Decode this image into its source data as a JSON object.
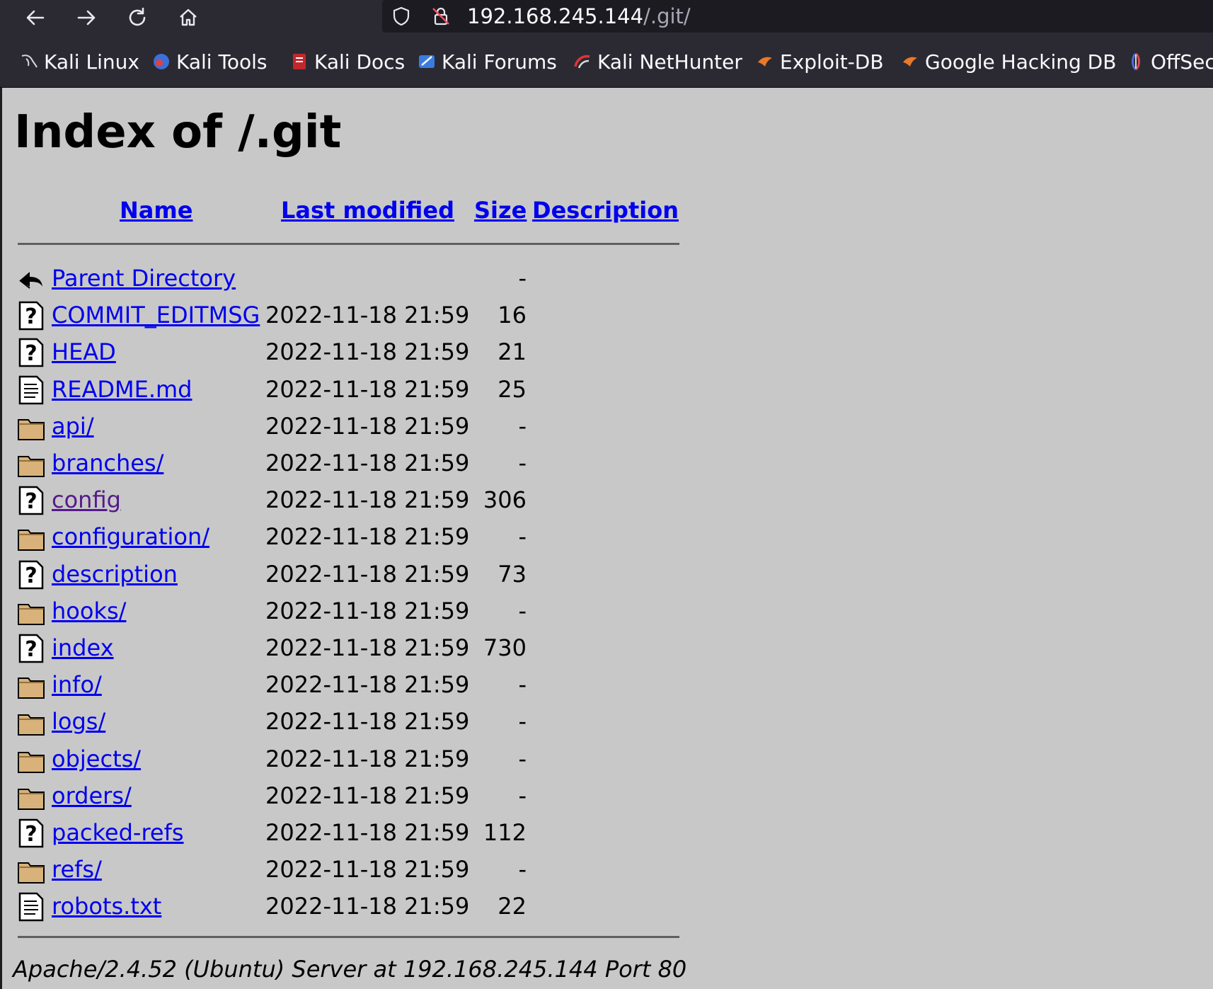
{
  "browser": {
    "url_host": "192.168.245.144",
    "url_path": "/.git/",
    "bookmarks": [
      {
        "label": "Kali Linux",
        "icon": "kali-dragon-icon"
      },
      {
        "label": "Kali Tools",
        "icon": "kali-tools-icon"
      },
      {
        "label": "Kali Docs",
        "icon": "kali-docs-icon"
      },
      {
        "label": "Kali Forums",
        "icon": "kali-forums-icon"
      },
      {
        "label": "Kali NetHunter",
        "icon": "kali-nethunter-icon"
      },
      {
        "label": "Exploit-DB",
        "icon": "exploit-db-icon"
      },
      {
        "label": "Google Hacking DB",
        "icon": "ghdb-icon"
      },
      {
        "label": "OffSec",
        "icon": "offsec-icon"
      }
    ]
  },
  "page": {
    "title": "Index of /.git",
    "columns": {
      "name": "Name",
      "last_modified": "Last modified",
      "size": "Size",
      "description": "Description"
    },
    "entries": [
      {
        "name": "Parent Directory",
        "date": "",
        "size": "-",
        "icon": "back-icon"
      },
      {
        "name": "COMMIT_EDITMSG",
        "date": "2022-11-18 21:59",
        "size": "16",
        "icon": "unknown-file-icon"
      },
      {
        "name": "HEAD",
        "date": "2022-11-18 21:59",
        "size": "21",
        "icon": "unknown-file-icon"
      },
      {
        "name": "README.md",
        "date": "2022-11-18 21:59",
        "size": "25",
        "icon": "text-file-icon"
      },
      {
        "name": "api/",
        "date": "2022-11-18 21:59",
        "size": "-",
        "icon": "folder-icon"
      },
      {
        "name": "branches/",
        "date": "2022-11-18 21:59",
        "size": "-",
        "icon": "folder-icon"
      },
      {
        "name": "config",
        "date": "2022-11-18 21:59",
        "size": "306",
        "icon": "unknown-file-icon",
        "visited": true
      },
      {
        "name": "configuration/",
        "date": "2022-11-18 21:59",
        "size": "-",
        "icon": "folder-icon"
      },
      {
        "name": "description",
        "date": "2022-11-18 21:59",
        "size": "73",
        "icon": "unknown-file-icon"
      },
      {
        "name": "hooks/",
        "date": "2022-11-18 21:59",
        "size": "-",
        "icon": "folder-icon"
      },
      {
        "name": "index",
        "date": "2022-11-18 21:59",
        "size": "730",
        "icon": "unknown-file-icon"
      },
      {
        "name": "info/",
        "date": "2022-11-18 21:59",
        "size": "-",
        "icon": "folder-icon"
      },
      {
        "name": "logs/",
        "date": "2022-11-18 21:59",
        "size": "-",
        "icon": "folder-icon"
      },
      {
        "name": "objects/",
        "date": "2022-11-18 21:59",
        "size": "-",
        "icon": "folder-icon"
      },
      {
        "name": "orders/",
        "date": "2022-11-18 21:59",
        "size": "-",
        "icon": "folder-icon"
      },
      {
        "name": "packed-refs",
        "date": "2022-11-18 21:59",
        "size": "112",
        "icon": "unknown-file-icon"
      },
      {
        "name": "refs/",
        "date": "2022-11-18 21:59",
        "size": "-",
        "icon": "folder-icon"
      },
      {
        "name": "robots.txt",
        "date": "2022-11-18 21:59",
        "size": "22",
        "icon": "text-file-icon"
      }
    ],
    "footer": "Apache/2.4.52 (Ubuntu) Server at 192.168.245.144 Port 80"
  },
  "colors": {
    "page_bg": "#c8c8c8",
    "link": "#0000ee",
    "visited_link": "#551a8b",
    "chrome_bg": "#2b2a33",
    "urlbar_bg": "#1c1b22"
  }
}
